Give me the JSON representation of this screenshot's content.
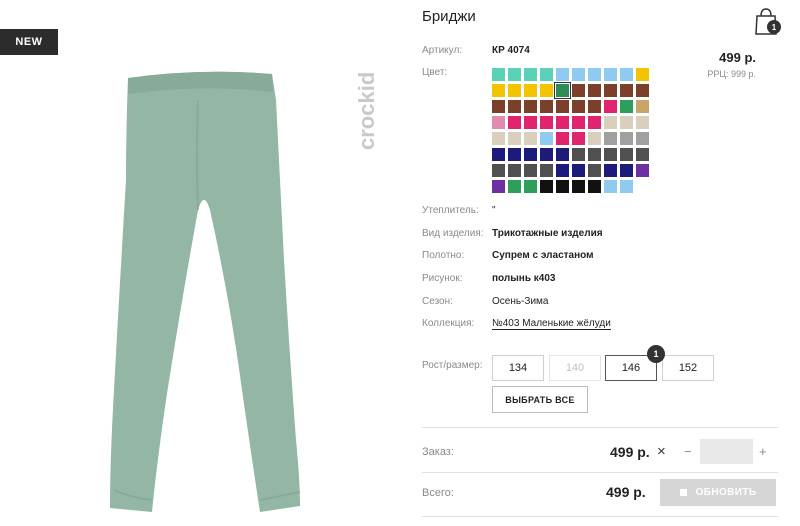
{
  "badge": "NEW",
  "brand": "crockid",
  "product": {
    "title": "Бриджи",
    "article_label": "Артикул:",
    "article": "КР 4074",
    "price": "499 р.",
    "rrp": "РРЦ: 999 р.",
    "color_label": "Цвет:",
    "swatches": [
      "#5bd1b8",
      "#5bd1b8",
      "#5bd1b8",
      "#5bd1b8",
      "#8fcbf0",
      "#8fcbf0",
      "#8fcbf0",
      "#8fcbf0",
      "#8fcbf0",
      "#f5c400",
      "#f5c400",
      "#f5c400",
      "#f5c400",
      "#f5c400",
      "#2e8b57",
      "#7b3f2a",
      "#7b3f2a",
      "#7b3f2a",
      "#7b3f2a",
      "#7b3f2a",
      "#7b3f2a",
      "#7b3f2a",
      "#7b3f2a",
      "#7b3f2a",
      "#7b3f2a",
      "#7b3f2a",
      "#7b3f2a",
      "#e0256e",
      "#2e9e5b",
      "#c9a56a",
      "#e08cb0",
      "#e0256e",
      "#e0256e",
      "#e0256e",
      "#e0256e",
      "#e0256e",
      "#e0256e",
      "#d8d0bc",
      "#d8d0bc",
      "#d8d0bc",
      "#d8d0bc",
      "#d8d0bc",
      "#d8d0bc",
      "#8fcbf0",
      "#e0256e",
      "#e0256e",
      "#d8d0bc",
      "#a0a0a0",
      "#a0a0a0",
      "#a0a0a0",
      "#1c1a7a",
      "#1c1a7a",
      "#1c1a7a",
      "#1c1a7a",
      "#1c1a7a",
      "#505050",
      "#505050",
      "#505050",
      "#505050",
      "#505050",
      "#505050",
      "#505050",
      "#505050",
      "#505050",
      "#1c1a7a",
      "#1c1a7a",
      "#505050",
      "#1c1a7a",
      "#1c1a7a",
      "#6e2fa0",
      "#6e2fa0",
      "#2e9e5b",
      "#2e9e5b",
      "#111111",
      "#111111",
      "#111111",
      "#111111",
      "#8fcbf0",
      "#8fcbf0"
    ],
    "insulation_label": "Утеплитель:",
    "insulation": "\"",
    "type_label": "Вид изделия:",
    "type": "Трикотажные изделия",
    "fabric_label": "Полотно:",
    "fabric": "Супрем с эластаном",
    "pattern_label": "Рисунок:",
    "pattern": "полынь к403",
    "season_label": "Сезон:",
    "season": "Осень-Зима",
    "collection_label": "Коллекция:",
    "collection": "№403 Маленькие жёлуди",
    "size_label": "Рост/размер:",
    "sizes": [
      "134",
      "140",
      "146",
      "152"
    ],
    "size_qty": "1",
    "select_all": "ВЫБРАТЬ ВСЕ"
  },
  "cart": {
    "count": "1"
  },
  "order": {
    "label": "Заказ:",
    "price": "499 р.",
    "remove": "×",
    "minus": "−",
    "plus": "+",
    "qty": ""
  },
  "total": {
    "label": "Всего:",
    "price": "499 р.",
    "update": "ОБНОВИТЬ"
  }
}
